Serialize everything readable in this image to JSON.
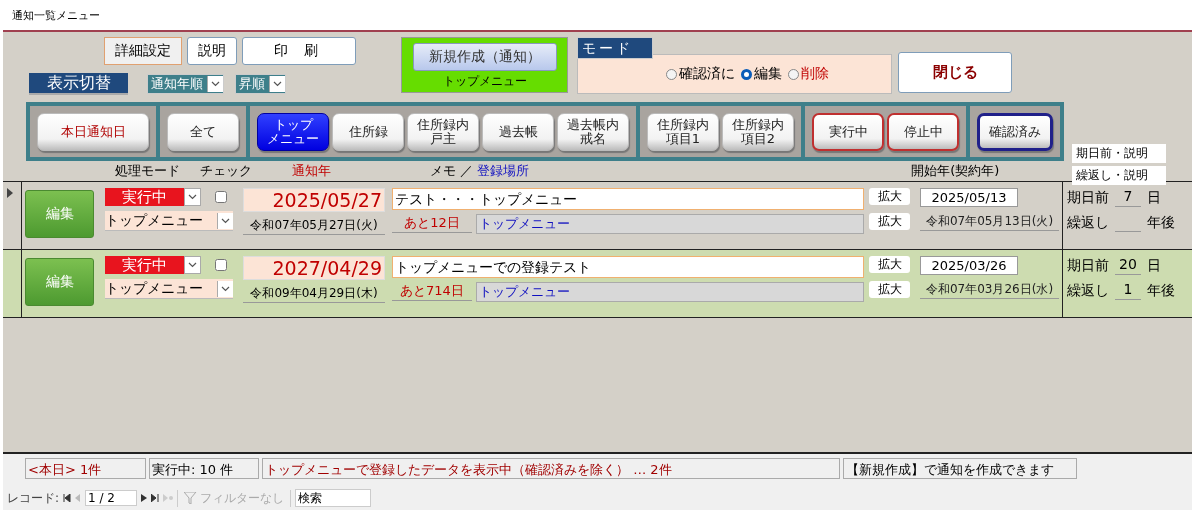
{
  "window": {
    "title": "通知一覧メニュー"
  },
  "toolbar": {
    "buttons": [
      "詳細設定",
      "説明",
      "印 刷"
    ],
    "view_label": "表示切替",
    "sort_field": "通知年順",
    "sort_order": "昇順"
  },
  "new_panel": {
    "button": "新規作成（通知）",
    "caption": "トップメニュー"
  },
  "mode": {
    "title": "モード",
    "options": [
      {
        "label": "確認済に",
        "selected": false,
        "kind": "plain"
      },
      {
        "label": "編集",
        "selected": true,
        "kind": "plain"
      },
      {
        "label": "削除",
        "selected": false,
        "kind": "alert"
      }
    ]
  },
  "close_button": "閉じる",
  "filter_groups": [
    [
      {
        "lines": [
          "本日通知日"
        ],
        "kind": "alert",
        "selected": false
      }
    ],
    [
      {
        "lines": [
          "全て"
        ],
        "kind": "plain",
        "selected": false
      }
    ],
    [
      {
        "lines": [
          "トップ",
          "メニュー"
        ],
        "kind": "plain",
        "selected": true
      },
      {
        "lines": [
          "住所録"
        ],
        "kind": "plain",
        "selected": false
      },
      {
        "lines": [
          "住所録内",
          "戸主"
        ],
        "kind": "plain",
        "selected": false
      },
      {
        "lines": [
          "過去帳"
        ],
        "kind": "plain",
        "selected": false
      },
      {
        "lines": [
          "過去帳内",
          "戒名"
        ],
        "kind": "plain",
        "selected": false
      }
    ],
    [
      {
        "lines": [
          "住所録内",
          "項目1"
        ],
        "kind": "plain",
        "selected": false
      },
      {
        "lines": [
          "住所録内",
          "項目2"
        ],
        "kind": "plain",
        "selected": false
      }
    ],
    [
      {
        "lines": [
          "実行中"
        ],
        "kind": "red",
        "selected": false
      },
      {
        "lines": [
          "停止中"
        ],
        "kind": "red",
        "selected": false
      }
    ],
    [
      {
        "lines": [
          "確認済み"
        ],
        "kind": "navy",
        "selected": false
      }
    ]
  ],
  "help_labels": [
    "期日前・説明",
    "繰返し・説明"
  ],
  "columns": [
    {
      "label": "処理モード",
      "kind": "plain"
    },
    {
      "label": "チェック",
      "kind": "plain"
    },
    {
      "label": "通知年",
      "kind": "alert"
    },
    {
      "label": "メモ ／",
      "kind": "plain"
    },
    {
      "label": "登録場所",
      "kind": "link"
    },
    {
      "label": "開始年(契約年)",
      "kind": "plain"
    }
  ],
  "records": [
    {
      "selected": true,
      "edit": "編集",
      "status": "実行中",
      "checked": false,
      "notify_date": "2025/05/27",
      "memo": "テスト・・・トップメニュー",
      "category": "トップメニュー",
      "wareki": "令和07年05月27日(火)",
      "remaining": "あと12日",
      "location": "トップメニュー",
      "zoom_buttons": [
        "拡大",
        "拡大"
      ],
      "start_date": "2025/05/13",
      "start_wareki": "令和07年05月13日(火)",
      "days_before": {
        "label": "期日前",
        "value": "7",
        "unit": "日"
      },
      "repeat": {
        "label": "繰返し",
        "unit": "年後"
      }
    },
    {
      "selected": false,
      "edit": "編集",
      "status": "実行中",
      "checked": false,
      "notify_date": "2027/04/29",
      "memo": "トップメニューでの登録テスト",
      "category": "トップメニュー",
      "wareki": "令和09年04月29日(木)",
      "remaining": "あと714日",
      "location": "トップメニュー",
      "zoom_buttons": [
        "拡大",
        "拡大"
      ],
      "start_date": "2025/03/26",
      "start_wareki": "令和07年03月26日(水)",
      "days_before": {
        "label": "期日前",
        "value": "20",
        "unit": "日"
      },
      "repeat": {
        "label": "繰返し",
        "value": "1",
        "unit": "年後"
      }
    }
  ],
  "status": {
    "today": "<本日> 1件",
    "running": "実行中: 10 件",
    "message": "トップメニューで登録したデータを表示中（確認済みを除く） … 2件",
    "hint": "【新規作成】で通知を作成できます"
  },
  "navigator": {
    "label": "レコード:",
    "position": "1 / 2",
    "filter": "フィルターなし",
    "search_placeholder": "検索"
  }
}
